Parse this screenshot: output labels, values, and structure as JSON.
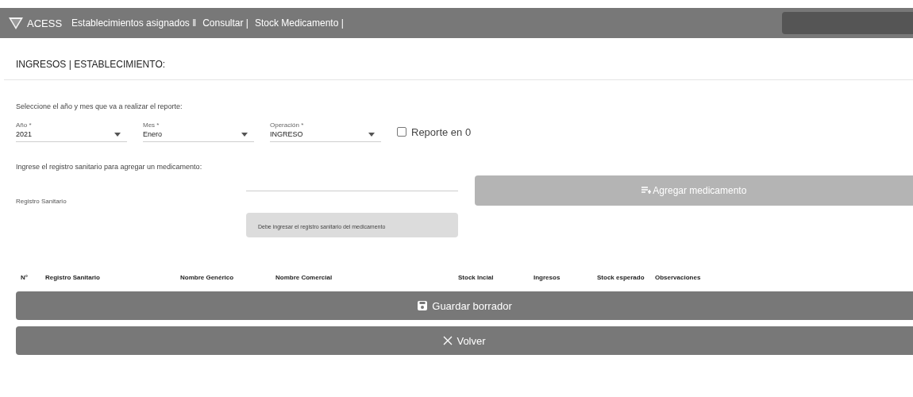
{
  "navbar": {
    "brand": "ACESS",
    "links": [
      {
        "label": "Establecimientos asignados ‖"
      },
      {
        "label": "Consultar |"
      },
      {
        "label": "Stock Medicamento |"
      }
    ]
  },
  "page_title": "INGRESOS | ESTABLECIMIENTO:",
  "period_prompt": "Seleccione el año y mes que va a realizar el reporte:",
  "selects": [
    {
      "label": "Año *",
      "value": "2021"
    },
    {
      "label": "Mes *",
      "value": "Enero"
    },
    {
      "label": "Operación *",
      "value": "INGRESO"
    }
  ],
  "zero_report": {
    "label": "Reporte en 0",
    "checked": false
  },
  "register_prompt": "Ingrese el registro sanitario para agregar un medicamento:",
  "register_label": "Registro Sanitario",
  "register_hint": "Debe ingresar el registro sanitario del medicamento",
  "add_button": {
    "label": "Agregar medicamento",
    "disabled": true
  },
  "table": {
    "columns": [
      "N°",
      "Registro Sanitario",
      "Nombre Genérico",
      "Nombre Comercial",
      "Stock Incial",
      "Ingresos",
      "Stock esperado",
      "Observaciones"
    ]
  },
  "buttons": [
    {
      "kind": "save",
      "label": "Guardar borrador"
    },
    {
      "kind": "back",
      "label": "Volver"
    }
  ]
}
